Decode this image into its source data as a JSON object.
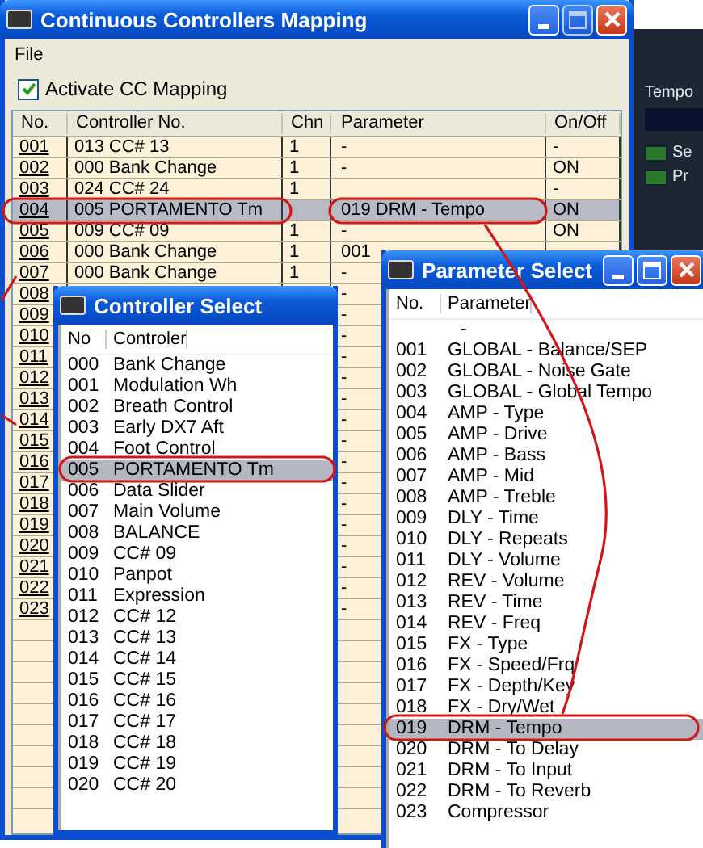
{
  "background_app": {
    "heading": "Tempo",
    "indicators": [
      {
        "label": "Se"
      },
      {
        "label": "Pr"
      }
    ]
  },
  "main_window": {
    "title": "Continuous Controllers Mapping",
    "menu": [
      "File"
    ],
    "activate_checkbox": {
      "label": "Activate CC Mapping",
      "checked": true
    },
    "columns": [
      "No.",
      "Controller No.",
      "Chn",
      "Parameter",
      "On/Off"
    ],
    "rows": [
      {
        "no": "001",
        "controller": "013 CC# 13",
        "chn": "1",
        "parameter": "-",
        "on_off": "-",
        "selected": false
      },
      {
        "no": "002",
        "controller": "000 Bank Change",
        "chn": "1",
        "parameter": "-",
        "on_off": "ON",
        "selected": false
      },
      {
        "no": "003",
        "controller": "024 CC# 24",
        "chn": "1",
        "on_off": "-",
        "selected": false
      },
      {
        "no": "004",
        "controller": "005 PORTAMENTO Tm",
        "parameter": "019 DRM - Tempo",
        "on_off": "ON",
        "selected": true
      },
      {
        "no": "005",
        "controller": "009 CC# 09",
        "chn": "1",
        "parameter": "-",
        "on_off": "ON",
        "selected": false
      },
      {
        "no": "006",
        "controller": "000 Bank Change",
        "chn": "1",
        "parameter": "001",
        "selected": false
      },
      {
        "no": "007",
        "controller": "000 Bank Change",
        "chn": "1",
        "parameter": "-",
        "selected": false
      },
      {
        "no": "008",
        "parameter": "-",
        "selected": false
      },
      {
        "no": "009",
        "parameter": "-",
        "selected": false
      },
      {
        "no": "010",
        "parameter": "-",
        "selected": false
      },
      {
        "no": "011",
        "parameter": "-",
        "selected": false
      },
      {
        "no": "012",
        "parameter": "-",
        "selected": false
      },
      {
        "no": "013",
        "parameter": "-",
        "selected": false
      },
      {
        "no": "014",
        "parameter": "-",
        "selected": false
      },
      {
        "no": "015",
        "parameter": "-",
        "selected": false
      },
      {
        "no": "016",
        "parameter": "-",
        "selected": false
      },
      {
        "no": "017",
        "parameter": "-",
        "selected": false
      },
      {
        "no": "018",
        "parameter": "-",
        "selected": false
      },
      {
        "no": "019",
        "parameter": "-",
        "selected": false
      },
      {
        "no": "020",
        "parameter": "-",
        "selected": false
      },
      {
        "no": "021",
        "parameter": "-",
        "selected": false
      },
      {
        "no": "022",
        "parameter": "-",
        "selected": false
      },
      {
        "no": "023",
        "parameter": "-",
        "selected": false
      }
    ]
  },
  "controller_select": {
    "title": "Controller Select",
    "columns": [
      "No",
      "Controler"
    ],
    "items": [
      {
        "no": "000",
        "name": "Bank Change",
        "selected": false
      },
      {
        "no": "001",
        "name": "Modulation Wh",
        "selected": false
      },
      {
        "no": "002",
        "name": "Breath Control",
        "selected": false
      },
      {
        "no": "003",
        "name": "Early DX7 Aft",
        "selected": false
      },
      {
        "no": "004",
        "name": "Foot Control",
        "selected": false
      },
      {
        "no": "005",
        "name": "PORTAMENTO Tm",
        "selected": true
      },
      {
        "no": "006",
        "name": "Data Slider",
        "selected": false
      },
      {
        "no": "007",
        "name": "Main Volume",
        "selected": false
      },
      {
        "no": "008",
        "name": "BALANCE",
        "selected": false
      },
      {
        "no": "009",
        "name": "CC# 09",
        "selected": false
      },
      {
        "no": "010",
        "name": "Panpot",
        "selected": false
      },
      {
        "no": "011",
        "name": "Expression",
        "selected": false
      },
      {
        "no": "012",
        "name": "CC# 12",
        "selected": false
      },
      {
        "no": "013",
        "name": "CC# 13",
        "selected": false
      },
      {
        "no": "014",
        "name": "CC# 14",
        "selected": false
      },
      {
        "no": "015",
        "name": "CC# 15",
        "selected": false
      },
      {
        "no": "016",
        "name": "CC# 16",
        "selected": false
      },
      {
        "no": "017",
        "name": "CC# 17",
        "selected": false
      },
      {
        "no": "018",
        "name": "CC# 18",
        "selected": false
      },
      {
        "no": "019",
        "name": "CC# 19",
        "selected": false
      },
      {
        "no": "020",
        "name": "CC# 20",
        "selected": false
      }
    ]
  },
  "parameter_select": {
    "title": "Parameter Select",
    "columns": [
      "No.",
      "Parameter"
    ],
    "items": [
      {
        "name": "-",
        "selected": false
      },
      {
        "no": "001",
        "name": "GLOBAL - Balance/SEP",
        "selected": false
      },
      {
        "no": "002",
        "name": "GLOBAL - Noise Gate",
        "selected": false
      },
      {
        "no": "003",
        "name": "GLOBAL - Global Tempo",
        "selected": false
      },
      {
        "no": "004",
        "name": "AMP - Type",
        "selected": false
      },
      {
        "no": "005",
        "name": "AMP - Drive",
        "selected": false
      },
      {
        "no": "006",
        "name": "AMP - Bass",
        "selected": false
      },
      {
        "no": "007",
        "name": "AMP - Mid",
        "selected": false
      },
      {
        "no": "008",
        "name": "AMP - Treble",
        "selected": false
      },
      {
        "no": "009",
        "name": "DLY - Time",
        "selected": false
      },
      {
        "no": "010",
        "name": "DLY - Repeats",
        "selected": false
      },
      {
        "no": "011",
        "name": "DLY - Volume",
        "selected": false
      },
      {
        "no": "012",
        "name": "REV - Volume",
        "selected": false
      },
      {
        "no": "013",
        "name": "REV - Time",
        "selected": false
      },
      {
        "no": "014",
        "name": "REV - Freq",
        "selected": false
      },
      {
        "no": "015",
        "name": "FX - Type",
        "selected": false
      },
      {
        "no": "016",
        "name": "FX - Speed/Frq",
        "selected": false
      },
      {
        "no": "017",
        "name": "FX - Depth/Key",
        "selected": false
      },
      {
        "no": "018",
        "name": "FX - Dry/Wet",
        "selected": false
      },
      {
        "no": "019",
        "name": "DRM - Tempo",
        "selected": true
      },
      {
        "no": "020",
        "name": "DRM - To Delay",
        "selected": false
      },
      {
        "no": "021",
        "name": "DRM - To Input",
        "selected": false
      },
      {
        "no": "022",
        "name": "DRM - To Reverb",
        "selected": false
      },
      {
        "no": "023",
        "name": "Compressor",
        "selected": false
      }
    ]
  }
}
